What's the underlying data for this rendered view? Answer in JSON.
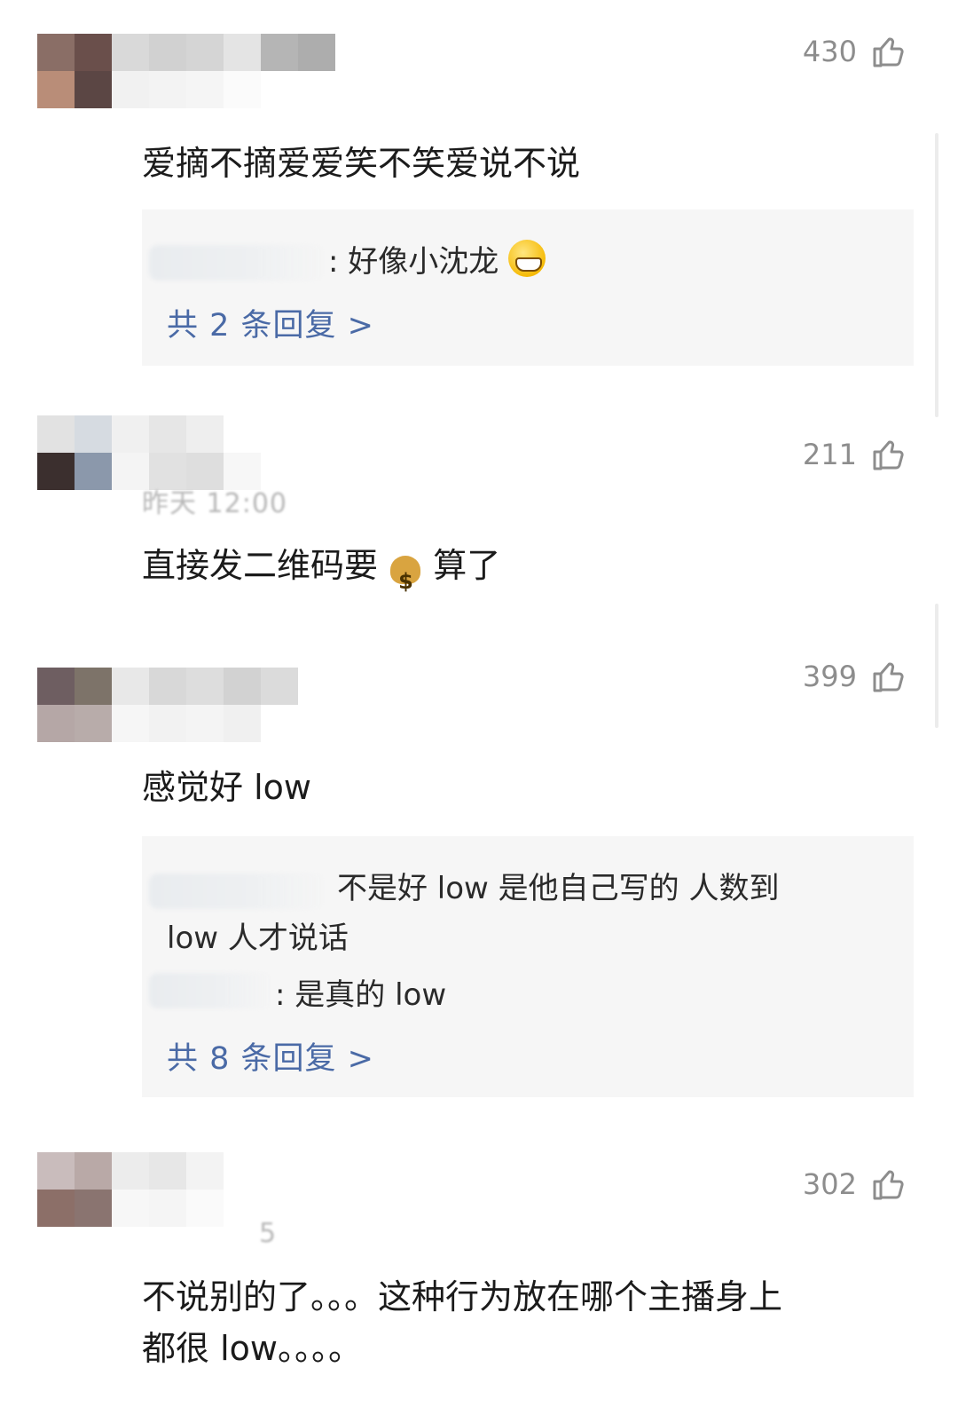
{
  "comments": [
    {
      "likes": "430",
      "body": "爱摘不摘爱爱笑不笑爱说不说",
      "replies": [
        {
          "text": ": 好像小沈龙"
        }
      ],
      "more_replies": "共 2 条回复 >"
    },
    {
      "likes": "211",
      "meta": "昨天 12:00",
      "body_before": "直接发二维码要",
      "body_after": "算了"
    },
    {
      "likes": "399",
      "body": "感觉好 low",
      "replies": [
        {
          "text": "不是好 low 是他自己写的  人数到"
        },
        {
          "text": "low 人才说话"
        },
        {
          "text": ": 是真的 low"
        }
      ],
      "more_replies": "共 8 条回复 >"
    },
    {
      "likes": "302",
      "meta": "5",
      "body_line1": "不说别的了。。。这种行为放在哪个主播身上",
      "body_line2": "都很 low。。。。"
    }
  ],
  "icons": {
    "like": "thumbs-up-outline-icon",
    "grin": "grinning-face-emoji",
    "money_bag": "money-bag-emoji"
  },
  "colors": {
    "reply_box_bg": "#f6f6f6",
    "link_blue": "#4a6aa6",
    "meta_gray": "#8d8d8d"
  }
}
